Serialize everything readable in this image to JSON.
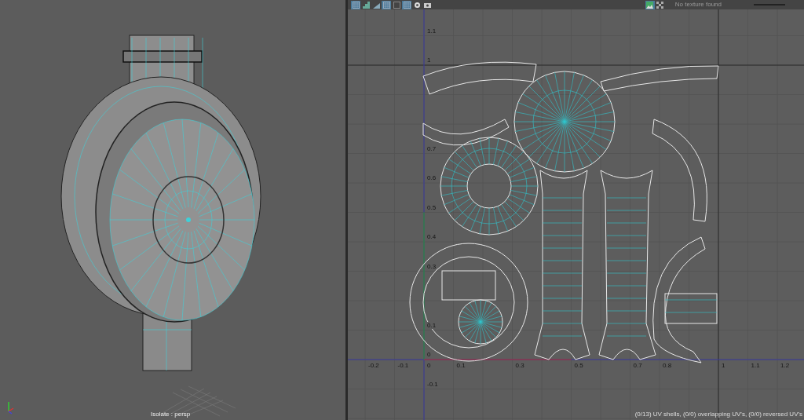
{
  "viewport": {
    "label": "Isolate : persp"
  },
  "uv_editor": {
    "tools": [
      {
        "kind": "grid",
        "selected": true
      },
      {
        "kind": "bars",
        "selected": false
      },
      {
        "kind": "shade",
        "selected": false
      },
      {
        "kind": "grid",
        "selected": true
      },
      {
        "kind": "frame",
        "selected": false
      },
      {
        "kind": "grid",
        "selected": true
      },
      {
        "kind": "dot",
        "selected": false
      },
      {
        "kind": "camera",
        "selected": false
      }
    ],
    "right_tools": [
      {
        "kind": "image",
        "selected": true
      },
      {
        "kind": "checker",
        "selected": false
      }
    ],
    "texture_status": "No texture found",
    "x_axis_labels": [
      "-0.2",
      "-0.1",
      "0",
      "0.1",
      "0.3",
      "0.5",
      "0.7",
      "0.8",
      "1",
      "1.1",
      "1.2"
    ],
    "y_axis_labels": [
      "1.1",
      "1",
      "0.7",
      "0.6",
      "0.5",
      "0.4",
      "0.3",
      "0.1",
      "0",
      "-0.1"
    ],
    "status": "(0/13) UV shells, (0/0) overlapping UV's, (0/0) reversed UV's"
  }
}
